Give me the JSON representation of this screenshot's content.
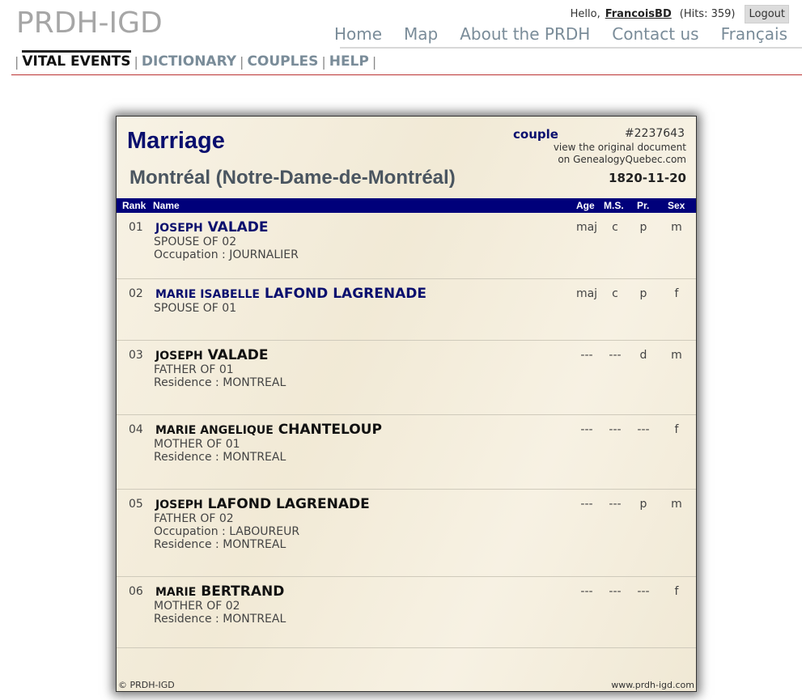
{
  "header": {
    "logo": "PRDH-IGD",
    "hello": "Hello,",
    "username": "FrancoisBD",
    "hits": "(Hits: 359)",
    "logout": "Logout"
  },
  "mainnav": [
    "Home",
    "Map",
    "About the PRDH",
    "Contact us",
    "Français"
  ],
  "subnav": [
    "VITAL EVENTS",
    "DICTIONARY",
    "COUPLES",
    "HELP"
  ],
  "record": {
    "title": "Marriage",
    "place": "Montréal (Notre-Dame-de-Montréal)",
    "couple_link": "couple",
    "number": "#2237643",
    "view_line1": "view the original document",
    "view_line2": "on GenealogyQuebec.com",
    "date": "1820-11-20",
    "columns": {
      "rank": "Rank",
      "name": "Name",
      "age": "Age",
      "ms": "M.S.",
      "pr": "Pr.",
      "sex": "Sex"
    },
    "people": [
      {
        "rank": "01",
        "given": "JOSEPH",
        "surname": "VALADE",
        "lines": [
          "SPOUSE  OF 02",
          "Occupation : JOURNALIER"
        ],
        "age": "maj",
        "ms": "c",
        "pr": "p",
        "sex": "m"
      },
      {
        "rank": "02",
        "given": "MARIE ISABELLE",
        "surname": "LAFOND LAGRENADE",
        "lines": [
          "SPOUSE  OF 01"
        ],
        "age": "maj",
        "ms": "c",
        "pr": "p",
        "sex": "f"
      },
      {
        "rank": "03",
        "given": "JOSEPH",
        "surname": "VALADE",
        "lines": [
          "FATHER  OF 01",
          "Residence : MONTREAL"
        ],
        "age": "---",
        "ms": "---",
        "pr": "d",
        "sex": "m"
      },
      {
        "rank": "04",
        "given": "MARIE ANGELIQUE",
        "surname": "CHANTELOUP",
        "lines": [
          "MOTHER  OF 01",
          "Residence : MONTREAL"
        ],
        "age": "---",
        "ms": "---",
        "pr": "---",
        "sex": "f"
      },
      {
        "rank": "05",
        "given": "JOSEPH",
        "surname": "LAFOND LAGRENADE",
        "lines": [
          "FATHER  OF 02",
          "Occupation : LABOUREUR",
          "Residence : MONTREAL"
        ],
        "age": "---",
        "ms": "---",
        "pr": "p",
        "sex": "m"
      },
      {
        "rank": "06",
        "given": "MARIE",
        "surname": "BERTRAND",
        "lines": [
          "MOTHER  OF 02",
          "Residence : MONTREAL"
        ],
        "age": "---",
        "ms": "---",
        "pr": "---",
        "sex": "f"
      }
    ],
    "footer_left": "© PRDH-IGD",
    "footer_right": "www.prdh-igd.com"
  }
}
